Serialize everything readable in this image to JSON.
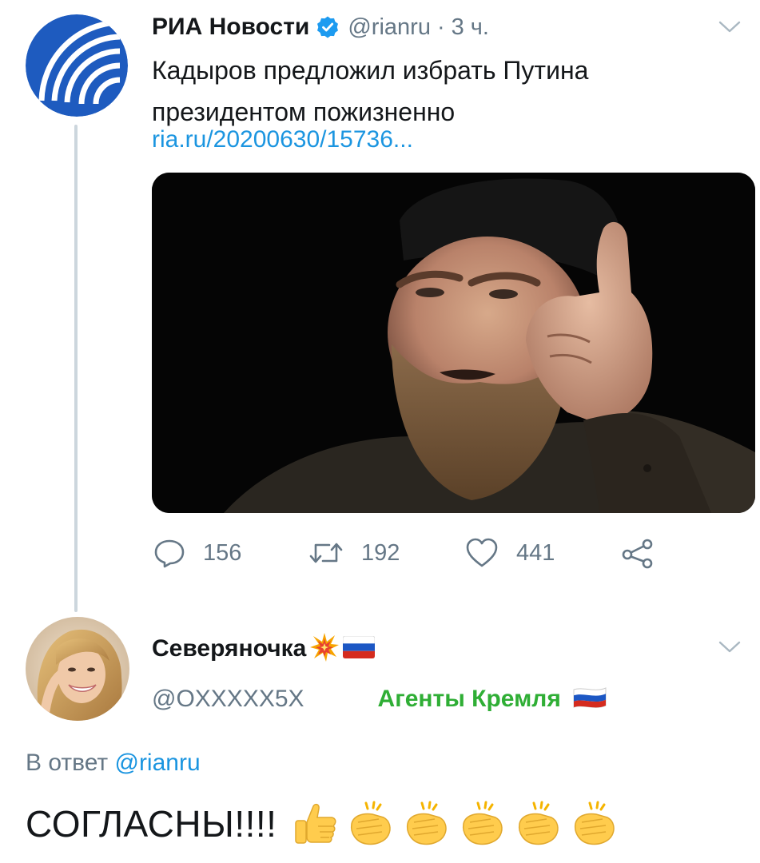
{
  "tweet": {
    "author": "РИА Новости",
    "handle": "@rianru",
    "separator": "·",
    "time": "3 ч.",
    "text": "Кадыров предложил избрать Путина президентом пожизненно",
    "link": "ria.ru/20200630/15736...",
    "media_icon": "photo",
    "stats": {
      "replies": "156",
      "retweets": "192",
      "likes": "441"
    },
    "icons": {
      "reply": "reply-icon",
      "retweet": "retweet-icon",
      "like": "heart-icon",
      "share": "share-icon",
      "verified": "verified-badge-icon",
      "caret": "chevron-down-icon"
    }
  },
  "reply": {
    "name": "Северяночка",
    "name_emoji": [
      "collision-icon",
      "russian-flag-icon"
    ],
    "handle": "@OXXXXX5X",
    "group_label": "Агенты Кремля",
    "group_emoji": "russian-flag-icon",
    "reply_prefix": "В ответ",
    "reply_mention": "@rianru",
    "text": "СОГЛАСНЫ!!!!",
    "text_emoji": [
      "thumbs-up-icon",
      "clapping-hands-icon",
      "clapping-hands-icon",
      "clapping-hands-icon",
      "clapping-hands-icon",
      "clapping-hands-icon"
    ]
  },
  "colors": {
    "link": "#1b95e0",
    "secondary_text": "#657786",
    "group_label": "#2fae35",
    "ria_blue": "#1e5bbf",
    "thread_line": "#ccd6dd"
  }
}
